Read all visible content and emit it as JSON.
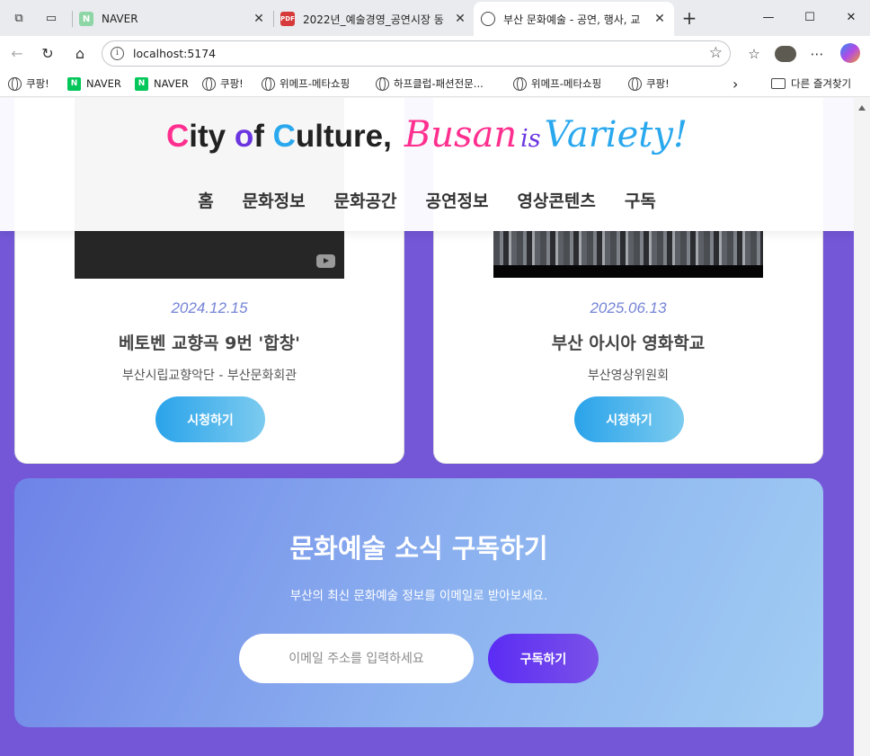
{
  "browser": {
    "tabs": [
      {
        "title": "NAVER"
      },
      {
        "title": "2022년_예술경영_공연시장 동"
      },
      {
        "title": "부산 문화예술 - 공연, 행사, 교"
      }
    ],
    "address": "localhost:5174",
    "bookmarks": [
      "쿠팡!",
      "NAVER",
      "NAVER",
      "쿠팡!",
      "위메프-메타쇼핑",
      "하프클럽-패션전문...",
      "위메프-메타쇼핑",
      "쿠팡!"
    ],
    "other_favorites": "다른 즐겨찾기"
  },
  "header": {
    "brand": {
      "c1": "C",
      "ity": "ity ",
      "o": "o",
      "f": "f ",
      "c2": "C",
      "ulture": "ulture,",
      "busan": "Busan",
      "is": "is",
      "variety": "Variety!"
    },
    "nav": [
      "홈",
      "문화정보",
      "문화공간",
      "공연정보",
      "영상콘텐츠",
      "구독"
    ]
  },
  "videos": [
    {
      "date": "2024.12.15",
      "title": "베토벤 교향곡 9번 '합창'",
      "subtitle": "부산시립교향악단 - 부산문화회관",
      "button": "시청하기"
    },
    {
      "date": "2025.06.13",
      "title": "부산 아시아 영화학교",
      "subtitle": "부산영상위원회",
      "button": "시청하기"
    }
  ],
  "subscribe": {
    "title": "문화예술 소식 구독하기",
    "description": "부산의 최신 문화예술 정보를 이메일로 받아보세요.",
    "email_placeholder": "이메일 주소를 입력하세요",
    "button": "구독하기"
  },
  "colors": {
    "page_background": "#7357d7",
    "pink": "#ff2f8f",
    "purple": "#6a35e0",
    "blue": "#2aa8ee"
  }
}
